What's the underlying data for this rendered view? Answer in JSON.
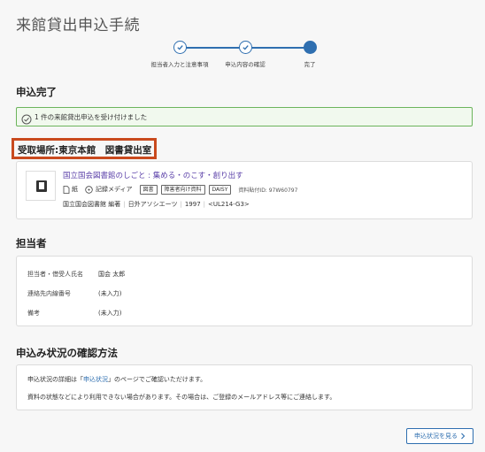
{
  "page": {
    "title": "来館貸出申込手続"
  },
  "stepper": {
    "steps": [
      {
        "label": "担当者入力と注意事項",
        "state": "done"
      },
      {
        "label": "申込内容の確認",
        "state": "done"
      },
      {
        "label": "完了",
        "state": "current"
      }
    ]
  },
  "complete": {
    "heading": "申込完了",
    "alert_text": "1 件の来館貸出申込を受け付けました",
    "alert_color": "#6cb45c"
  },
  "pickup": {
    "label": "受取場所:東京本館　図書貸出室",
    "highlight_color": "#c94a1e"
  },
  "book": {
    "title": "国立国会図書館のしごと : 集める・のこす・創り出す",
    "media": [
      {
        "icon": "paper-icon",
        "label": "紙"
      },
      {
        "icon": "recording-media-icon",
        "label": "記録メディア"
      }
    ],
    "tags": [
      "図書",
      "障害者向け資料",
      "DAISY"
    ],
    "material_id": "資料貼付ID: 97W60797",
    "author": "国立国会図書館 編著",
    "publisher": "日外アソシエーツ",
    "year": "1997",
    "call_number": "<UL214-G3>"
  },
  "staff": {
    "heading": "担当者",
    "fields": [
      {
        "label": "担当者・借受人氏名",
        "value": "国会 太郎"
      },
      {
        "label": "連絡先内線番号",
        "value": "(未入力)"
      },
      {
        "label": "備考",
        "value": "(未入力)"
      }
    ]
  },
  "status": {
    "heading": "申込み状況の確認方法",
    "line1_prefix": "申込状況の詳細は「",
    "line1_link": "申込状況",
    "line1_suffix": "」のページでご確認いただけます。",
    "line2": "資料の状態などにより利用できない場合があります。その場合は、ご登録のメールアドレス等にご連絡します。",
    "button_label": "申込状況を見る",
    "accent_color": "#2f6fb0"
  }
}
